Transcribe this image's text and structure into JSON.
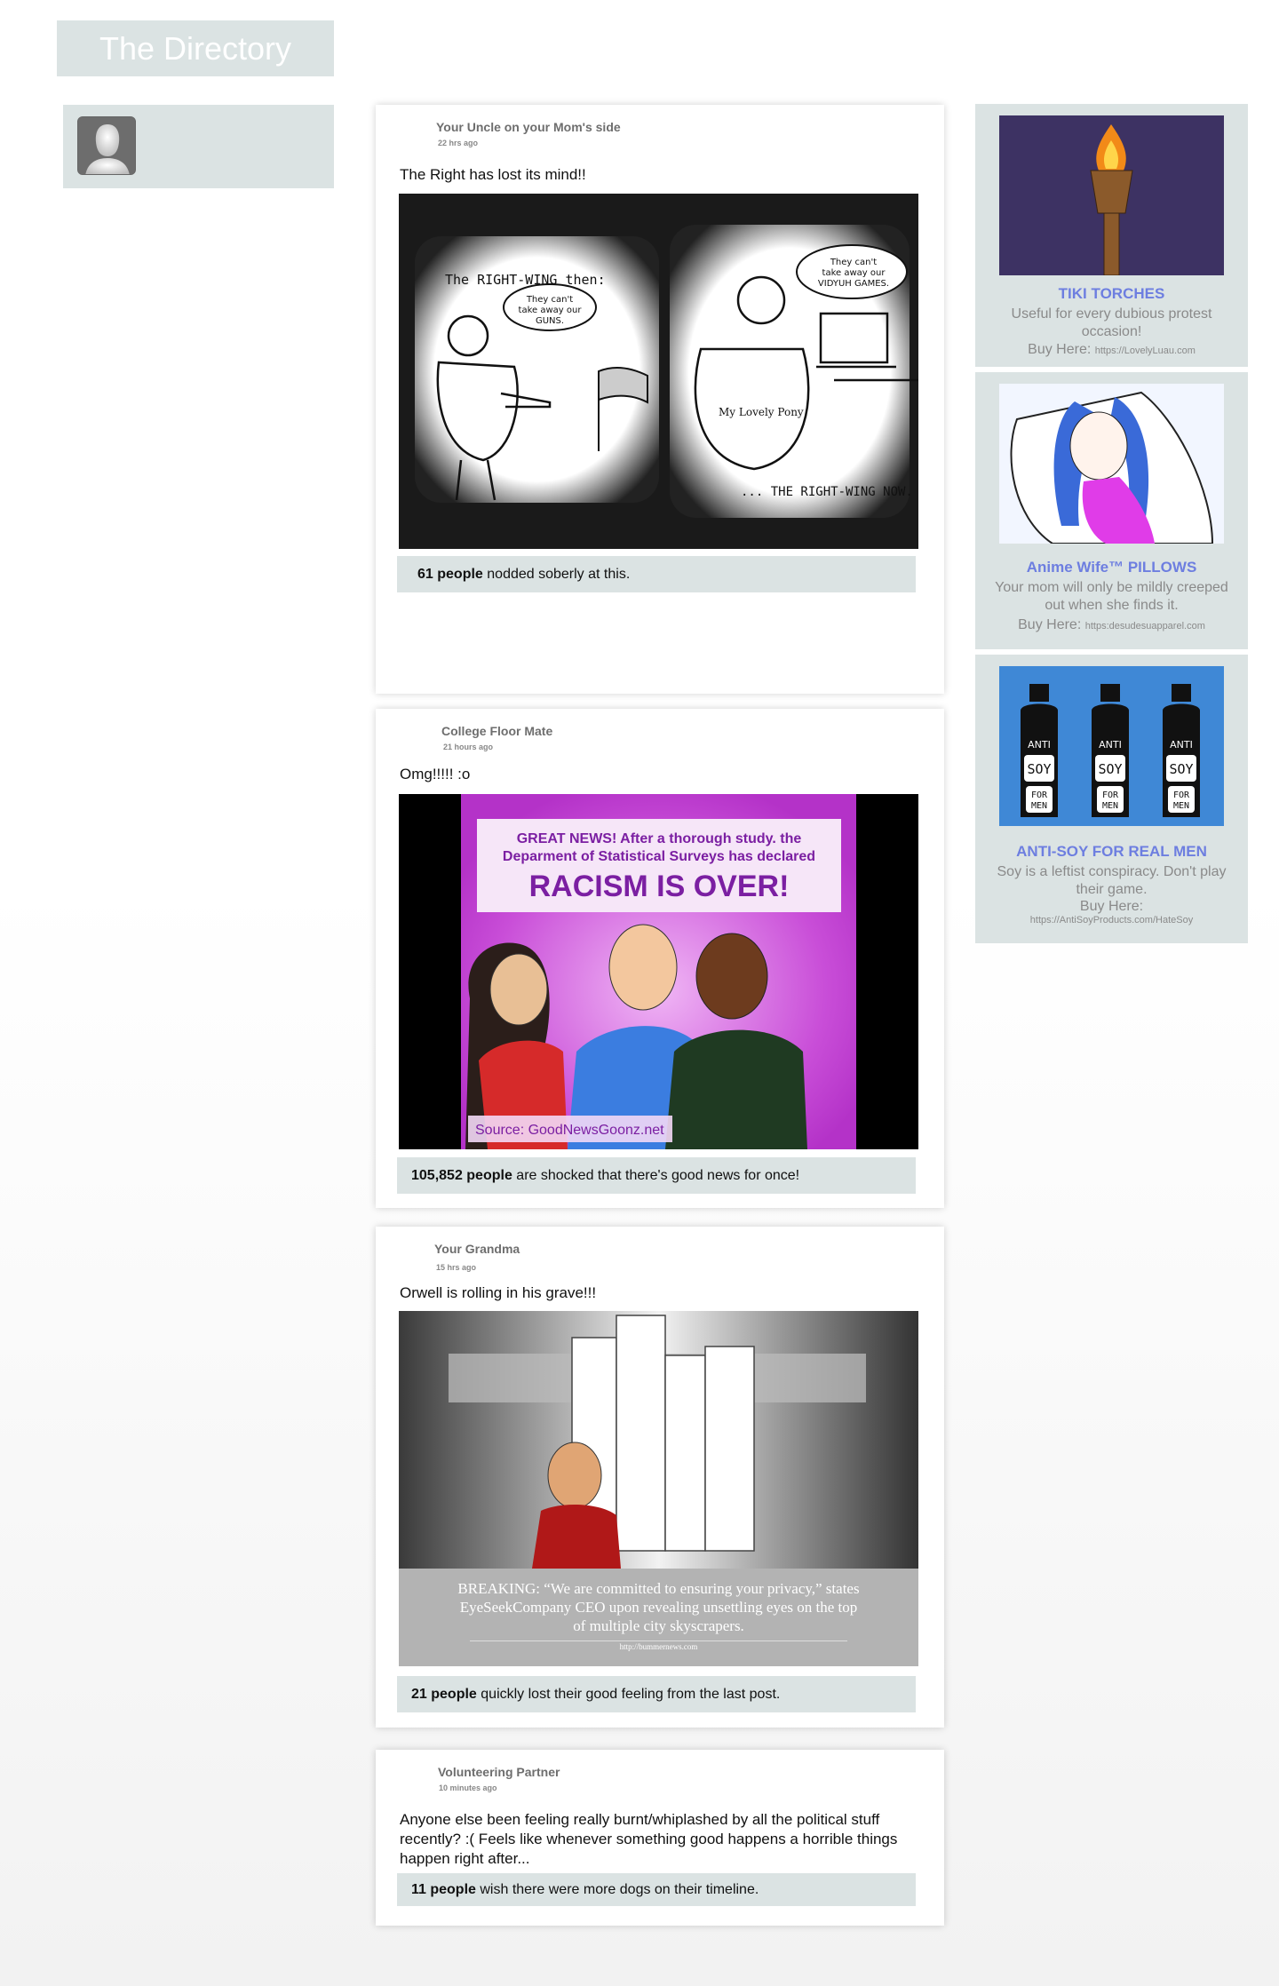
{
  "header": {
    "title": "The Directory"
  },
  "posts": [
    {
      "author": "Your Uncle on your Mom's side",
      "time": "22 hrs ago",
      "text": "The Right has lost its mind!!",
      "comic": {
        "left_caption": "The RIGHT-WING then:",
        "left_bubble": "They can't take away our GUNS.",
        "right_bubble": "They can't take away our VIDYUH GAMES.",
        "shirt": "My Lovely Pony",
        "right_caption": "... THE RIGHT-WING NOW."
      },
      "reaction_count": "61 people",
      "reaction_text": "nodded soberly at this."
    },
    {
      "author": "College Floor Mate",
      "time": "21 hours ago",
      "text": "Omg!!!!! :o",
      "image": {
        "headline": "GREAT NEWS! After a thorough study. the Deparment of Statistical Surveys has declared",
        "big": "RACISM IS OVER!",
        "source": "Source: GoodNewsGoonz.net"
      },
      "reaction_count": "105,852 people",
      "reaction_text": "are shocked that there's good news for once!"
    },
    {
      "author": "Your Grandma",
      "time": "15 hrs ago",
      "text": "Orwell is rolling in his grave!!!",
      "image": {
        "caption": "BREAKING: “We are committed to ensuring your privacy,” states EyeSeekCompany CEO upon revealing unsettling eyes on the top of multiple city skyscrapers.",
        "url": "http://bummernews.com"
      },
      "reaction_count": "21 people",
      "reaction_text": "quickly lost their good feeling from the last post."
    },
    {
      "author": "Volunteering Partner",
      "time": "10 minutes ago",
      "text": "Anyone else been feeling really burnt/whiplashed by all the political stuff recently? :( Feels like whenever something good happens a horrible things happen right after...",
      "reaction_count": "11 people",
      "reaction_text": "wish there were more dogs on their timeline."
    }
  ],
  "ads": [
    {
      "title": "TIKI TORCHES",
      "desc": "Useful for every dubious protest occasion!",
      "buy": "Buy Here:",
      "url": "https://LovelyLuau.com"
    },
    {
      "title": "Anime Wife™ PILLOWS",
      "desc": "Your mom will only be mildly creeped out when she finds it.",
      "buy": "Buy Here:",
      "url": "https:desudesuapparel.com"
    },
    {
      "title": "ANTI-SOY FOR REAL MEN",
      "desc": "Soy is a leftist conspiracy. Don't play their game.",
      "buy": "Buy Here:",
      "url": "https://AntiSoyProducts.com/HateSoy",
      "bottle_label": {
        "top": "ANTI",
        "mid": "SOY",
        "bottom1": "FOR",
        "bottom2": "MEN"
      }
    }
  ],
  "colors": {
    "panel": "#dbe3e3",
    "ad_title": "#6d7ee0",
    "muted": "#8a8a8a"
  },
  "icons": [
    "user-avatar-icon",
    "tiki-torch-icon"
  ]
}
